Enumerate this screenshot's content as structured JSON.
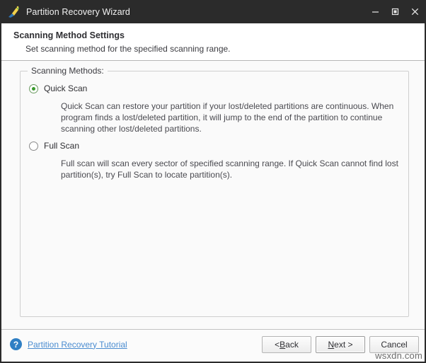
{
  "window": {
    "title": "Partition Recovery Wizard",
    "icon": "wizard-wand-icon",
    "controls": {
      "minimize": "minimize-icon",
      "maximize": "maximize-icon",
      "close": "close-icon"
    }
  },
  "header": {
    "title": "Scanning Method Settings",
    "subtitle": "Set scanning method for the specified scanning range."
  },
  "groupbox": {
    "legend": "Scanning Methods:",
    "options": [
      {
        "label": "Quick Scan",
        "selected": true,
        "description": "Quick Scan can restore your partition if your lost/deleted partitions are continuous. When program finds a lost/deleted partition, it will jump to the end of the partition to continue scanning other lost/deleted partitions."
      },
      {
        "label": "Full Scan",
        "selected": false,
        "description": "Full scan will scan every sector of specified scanning range. If Quick Scan cannot find lost partition(s), try Full Scan to locate partition(s)."
      }
    ]
  },
  "footer": {
    "help_icon": "question-mark-icon",
    "help_link": "Partition Recovery Tutorial",
    "buttons": {
      "back": "< Back",
      "next": "Next >",
      "cancel": "Cancel"
    },
    "watermark": "wsxdn.com"
  },
  "colors": {
    "titlebar": "#2b2b2b",
    "radio_selected": "#3a9a2e",
    "link": "#4a8cd0",
    "help_icon": "#2f7fc4"
  }
}
